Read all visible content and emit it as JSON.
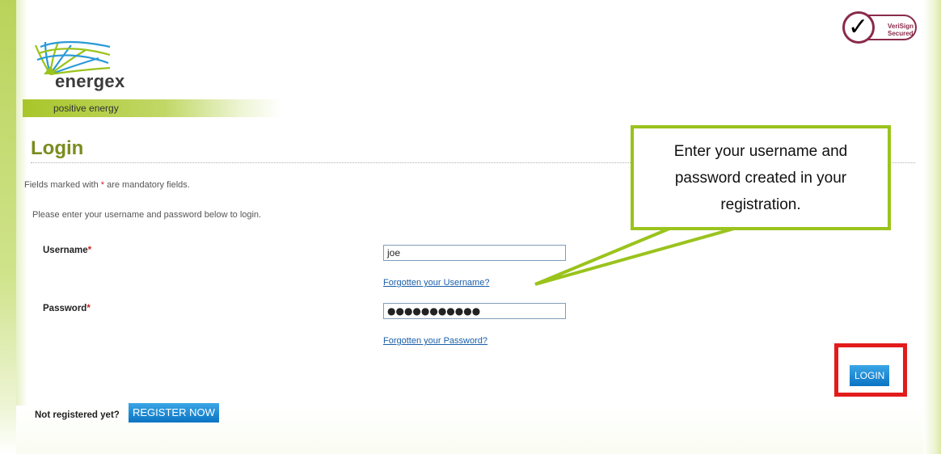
{
  "brand": {
    "logo_text": "energex",
    "tagline": "positive energy"
  },
  "badge": {
    "line1": "VeriSign",
    "line2": "Secured"
  },
  "page": {
    "title": "Login",
    "mandatory_prefix": "Fields marked with ",
    "mandatory_star": "*",
    "mandatory_suffix": " are mandatory fields.",
    "instructions": "Please enter your username and password below to login."
  },
  "form": {
    "username_label": "Username",
    "username_value": "joe",
    "forgot_username": "Forgotten your Username?",
    "password_label": "Password",
    "password_display": "●●●●●●●●●●●",
    "forgot_password": "Forgotten your Password?",
    "required_star": "*",
    "login_label": "LOGIN"
  },
  "register": {
    "prompt": "Not registered yet?",
    "button_label": "REGISTER NOW"
  },
  "callout": {
    "text": "Enter your username and password created in your registration."
  },
  "colors": {
    "accent_green": "#9ac31c",
    "title_olive": "#7a8c1e",
    "button_blue": "#0a74c4",
    "highlight_red": "#e31b1b",
    "link_blue": "#1a5fa8"
  }
}
